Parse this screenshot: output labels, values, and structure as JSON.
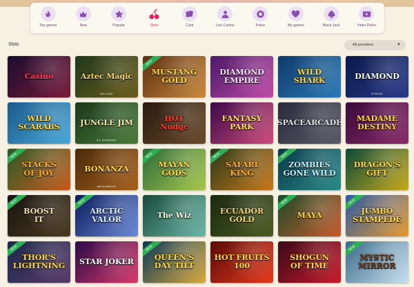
{
  "categories": [
    {
      "label": "Top games",
      "icon": "flame-icon",
      "active": false
    },
    {
      "label": "New",
      "icon": "crown-icon",
      "active": false
    },
    {
      "label": "Popular",
      "icon": "star-icon",
      "active": false
    },
    {
      "label": "Slots",
      "icon": "cherry-icon",
      "active": true
    },
    {
      "label": "Card",
      "icon": "cards-icon",
      "active": false
    },
    {
      "label": "Live Casino",
      "icon": "dealer-icon",
      "active": false
    },
    {
      "label": "Poker",
      "icon": "chip-icon",
      "active": false
    },
    {
      "label": "My games",
      "icon": "hearts-icon",
      "active": false
    },
    {
      "label": "Black Jack",
      "icon": "spade-icon",
      "active": false
    },
    {
      "label": "Video Poker",
      "icon": "play-icon",
      "active": false
    }
  ],
  "section": {
    "title": "Slots"
  },
  "provider_filter": {
    "selected": "All providers"
  },
  "badge_label": "NEW",
  "colors": {
    "accent": "#e0245e",
    "icon_purple": "#8a4fb0",
    "new_badge": "#2fae57",
    "background": "#f6f1e3"
  },
  "games": [
    {
      "title": "Casino",
      "subtitle": "",
      "isNew": false,
      "bg": [
        "#1a0d2e",
        "#7a1a3a"
      ],
      "text": "#ff3b5c"
    },
    {
      "title": "Aztec Magic",
      "subtitle": "DELUXE",
      "isNew": false,
      "bg": [
        "#1d3a1c",
        "#6b5a1a"
      ],
      "text": "#f2d27a"
    },
    {
      "title": "MUSTANG\nGOLD",
      "subtitle": "",
      "isNew": true,
      "bg": [
        "#5a2e12",
        "#c98a3a"
      ],
      "text": "#ffd84a"
    },
    {
      "title": "DIAMOND EMPIRE",
      "subtitle": "",
      "isNew": false,
      "bg": [
        "#4a1a6a",
        "#c24aa8"
      ],
      "text": "#ffe4ff"
    },
    {
      "title": "WILD\nSHARK",
      "subtitle": "",
      "isNew": false,
      "bg": [
        "#0f3a6a",
        "#2a7ab8"
      ],
      "text": "#ffd84a"
    },
    {
      "title": "DIAMOND",
      "subtitle": "STRIKE",
      "isNew": false,
      "bg": [
        "#0a1a4a",
        "#2a3a8a"
      ],
      "text": "#ffffff"
    },
    {
      "title": "WILD\nSCARABS",
      "subtitle": "",
      "isNew": false,
      "bg": [
        "#1a5a8a",
        "#4aa8d8"
      ],
      "text": "#ffd84a"
    },
    {
      "title": "JUNGLE JIM",
      "subtitle": "EL DORADO",
      "isNew": false,
      "bg": [
        "#1a3a1a",
        "#4a7a3a"
      ],
      "text": "#f5e6b0"
    },
    {
      "title": "HOT\nNudge",
      "subtitle": "",
      "isNew": false,
      "bg": [
        "#2a1a10",
        "#6a4a2a"
      ],
      "text": "#ff3a2a"
    },
    {
      "title": "FANTASY PARK",
      "subtitle": "",
      "isNew": false,
      "bg": [
        "#3a0a4a",
        "#d04a7a"
      ],
      "text": "#ffe060"
    },
    {
      "title": "SPACEARCADE",
      "subtitle": "",
      "isNew": false,
      "bg": [
        "#2a2a3a",
        "#5a5a6a"
      ],
      "text": "#e0e0e0"
    },
    {
      "title": "MADAME DESTINY",
      "subtitle": "",
      "isNew": false,
      "bg": [
        "#3a0a3a",
        "#8a2a6a"
      ],
      "text": "#ffd84a"
    },
    {
      "title": "STACKS\nOF JOY",
      "subtitle": "",
      "isNew": true,
      "bg": [
        "#2a5a2a",
        "#c85a1a"
      ],
      "text": "#ffb030"
    },
    {
      "title": "BONANZA",
      "subtitle": "MEGAWAYS",
      "isNew": false,
      "bg": [
        "#4a2a0a",
        "#a8601a"
      ],
      "text": "#ffd84a"
    },
    {
      "title": "MAYAN\nGODS",
      "subtitle": "",
      "isNew": true,
      "bg": [
        "#2a6a3a",
        "#a8c84a"
      ],
      "text": "#ffd84a"
    },
    {
      "title": "SAFARI KING",
      "subtitle": "",
      "isNew": true,
      "bg": [
        "#2a3a1a",
        "#c8781a"
      ],
      "text": "#ffb030"
    },
    {
      "title": "ZOMBIES\nGONE WILD",
      "subtitle": "",
      "isNew": true,
      "bg": [
        "#0a3a4a",
        "#2a8a8a"
      ],
      "text": "#c8f0ff"
    },
    {
      "title": "DRAGON'S GIFT",
      "subtitle": "",
      "isNew": false,
      "bg": [
        "#0a4a3a",
        "#c8a81a"
      ],
      "text": "#ffd84a"
    },
    {
      "title": "BOOST\nIT",
      "subtitle": "",
      "isNew": true,
      "bg": [
        "#1a1410",
        "#4a3a20"
      ],
      "text": "#f0e0b0"
    },
    {
      "title": "ARCTIC\nVALOR",
      "subtitle": "",
      "isNew": true,
      "bg": [
        "#0a1a5a",
        "#6a8ad8"
      ],
      "text": "#e0f0ff"
    },
    {
      "title": "The Wiz",
      "subtitle": "",
      "isNew": false,
      "bg": [
        "#1a4a3a",
        "#6ab8a8"
      ],
      "text": "#f0ffe0"
    },
    {
      "title": "ECUADOR\nGOLD",
      "subtitle": "",
      "isNew": false,
      "bg": [
        "#1a2a10",
        "#4a5a20"
      ],
      "text": "#f2d27a"
    },
    {
      "title": "MAYA",
      "subtitle": "",
      "isNew": true,
      "bg": [
        "#1a4a2a",
        "#c85a2a"
      ],
      "text": "#ffd84a"
    },
    {
      "title": "JUMBO\nSTAMPEDE",
      "subtitle": "",
      "isNew": true,
      "bg": [
        "#2a5aa8",
        "#e89a2a"
      ],
      "text": "#ffd84a"
    },
    {
      "title": "THOR'S\nLIGHTNING",
      "subtitle": "",
      "isNew": true,
      "bg": [
        "#1a2a4a",
        "#5a3a6a"
      ],
      "text": "#ffd84a"
    },
    {
      "title": "STAR JOKER",
      "subtitle": "",
      "isNew": false,
      "bg": [
        "#2a0a4a",
        "#d83a6a"
      ],
      "text": "#ffffff"
    },
    {
      "title": "QUEEN'S\nDAY TILT",
      "subtitle": "",
      "isNew": true,
      "bg": [
        "#0a3a5a",
        "#d8a83a"
      ],
      "text": "#ffd84a"
    },
    {
      "title": "HOT FRUITS 100",
      "subtitle": "",
      "isNew": false,
      "bg": [
        "#5a0a0a",
        "#e83a1a"
      ],
      "text": "#ffd84a"
    },
    {
      "title": "SHOGUN\nOF TIME",
      "subtitle": "",
      "isNew": false,
      "bg": [
        "#3a0a1a",
        "#c81a2a"
      ],
      "text": "#ffd84a"
    },
    {
      "title": "MYSTIC MIRROR",
      "subtitle": "",
      "isNew": true,
      "bg": [
        "#3a6a8a",
        "#c8e0f0"
      ],
      "text": "#6a3a1a"
    }
  ]
}
